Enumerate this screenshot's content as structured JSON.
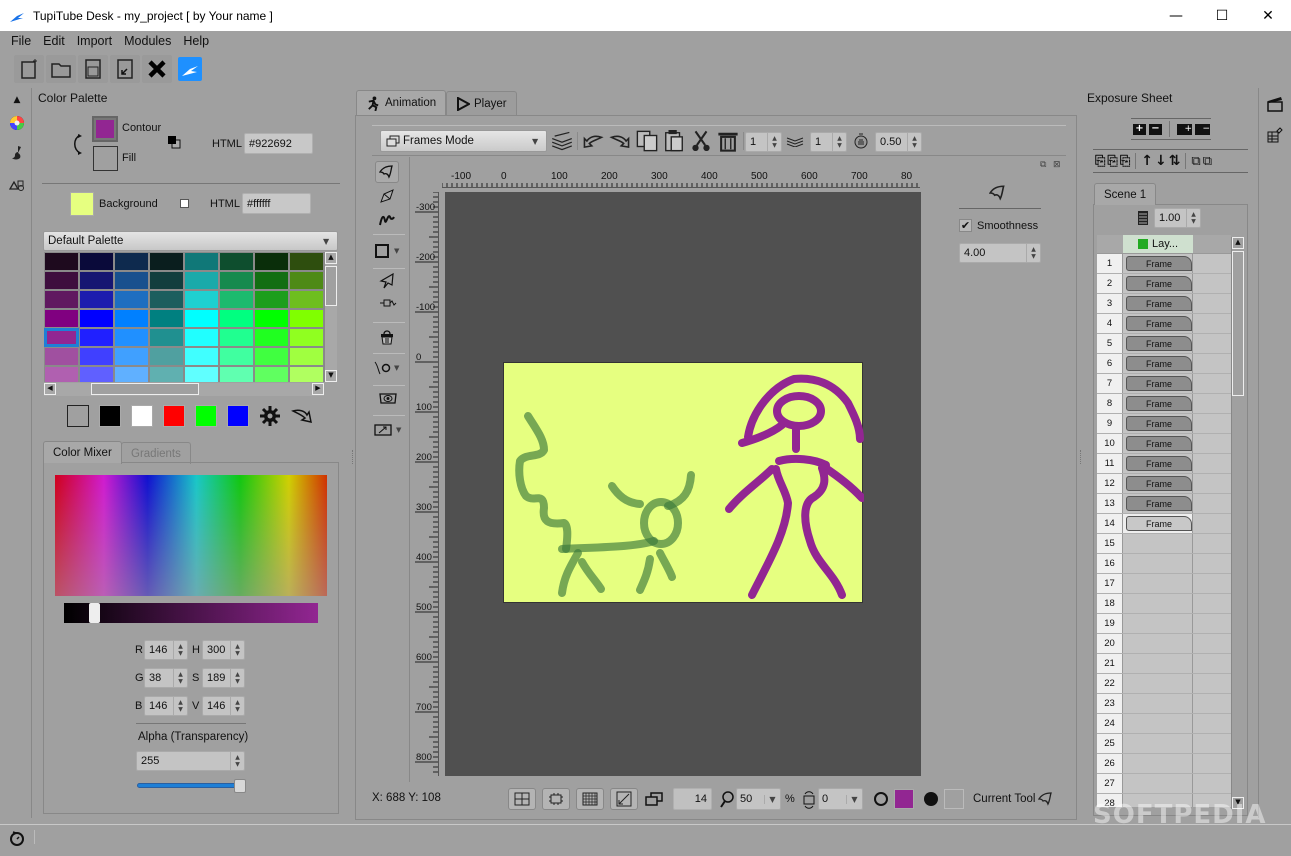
{
  "window": {
    "title": "TupiTube Desk - my_project [ by Your name ]",
    "controls": {
      "minimize": "—",
      "maximize": "☐",
      "close": "✕"
    }
  },
  "menu": [
    "File",
    "Edit",
    "Import",
    "Modules",
    "Help"
  ],
  "toolbar": {
    "icons": [
      "new-project-icon",
      "open-project-icon",
      "save-icon",
      "save-as-icon",
      "close-project-icon",
      "tupitube-icon"
    ]
  },
  "left_sidebar": {
    "icons": [
      "collapse-up-icon",
      "color-wheel-icon",
      "brush-icon",
      "shapes-icon"
    ]
  },
  "color_palette": {
    "title": "Color Palette",
    "contour_label": "Contour",
    "fill_label": "Fill",
    "html_label": "HTML",
    "contour_html": "#922692",
    "contour_color": "#922692",
    "background_label": "Background",
    "background_html_label": "HTML",
    "background_html": "#ffffff",
    "background_color": "#e6ff80",
    "palette_select": "Default Palette",
    "palette_colors": [
      [
        "#1e0a1e",
        "#0a0a3a",
        "#0e2a4e",
        "#0a1e1e",
        "#107878",
        "#0e4e2e",
        "#0a2e0a",
        "#2e4e0e"
      ],
      [
        "#3e0e3e",
        "#161672",
        "#18508e",
        "#123e3e",
        "#1aaaaa",
        "#168a4e",
        "#126e12",
        "#4e8a16"
      ],
      [
        "#601860",
        "#1c1cae",
        "#1e6ec0",
        "#1c5e5e",
        "#1ed0d0",
        "#1cba6e",
        "#1c9e1c",
        "#6ebe1e"
      ],
      [
        "#800080",
        "#0000ff",
        "#0080ff",
        "#008080",
        "#00ffff",
        "#00ff80",
        "#00ff00",
        "#80ff00"
      ],
      [
        "#922692",
        "#2020ff",
        "#2090ff",
        "#209090",
        "#20ffff",
        "#20ff90",
        "#20ff20",
        "#90ff20"
      ],
      [
        "#a050a0",
        "#4040ff",
        "#40a0ff",
        "#50a0a0",
        "#40ffff",
        "#40ffa0",
        "#40ff40",
        "#a0ff40"
      ],
      [
        "#b060b0",
        "#6060ff",
        "#60b0ff",
        "#60b0b0",
        "#60ffff",
        "#60ffb0",
        "#60ff60",
        "#b0ff60"
      ]
    ],
    "quick_colors": [
      "transparent",
      "#000000",
      "#ffffff",
      "#ff0000",
      "#00ff00",
      "#0000ff"
    ]
  },
  "color_mixer": {
    "tabs": [
      "Color Mixer",
      "Gradients"
    ],
    "R": "146",
    "G": "38",
    "B": "146",
    "H": "300",
    "S": "189",
    "V": "146",
    "alpha_label": "Alpha (Transparency)",
    "alpha": "255",
    "alpha_fraction": 1.0,
    "value_slider_fraction": 0.1
  },
  "main_tabs": [
    "Animation",
    "Player"
  ],
  "canvas_toolbar": {
    "mode": "Frames Mode",
    "spin1": "1",
    "spin2": "1",
    "opacity": "0.50"
  },
  "rulers": {
    "horizontal": [
      "-100",
      "0",
      "100",
      "200",
      "300",
      "400",
      "500",
      "600",
      "700",
      "80"
    ],
    "vertical": [
      "-300",
      "-200",
      "-100",
      "0",
      "100",
      "200",
      "300",
      "400",
      "500",
      "600",
      "700",
      "800"
    ]
  },
  "tool_options": {
    "smoothness_label": "Smoothness",
    "smoothness_checked": true,
    "smoothness_value": "4.00"
  },
  "status": {
    "coords": "X: 688 Y: 108",
    "frame": "14",
    "zoom": "50",
    "zoom_unit": "%",
    "rotation": "0",
    "stroke_color": "#922692",
    "fill_color": "#a0a0a0",
    "current_tool_label": "Current Tool"
  },
  "exposure_sheet": {
    "title": "Exposure Sheet",
    "scene_tab": "Scene 1",
    "fps": "1.00",
    "layer_label": "Lay...",
    "layer_color": "#22aa22",
    "frame_label": "Frame",
    "filled_frames": 14,
    "rows": [
      "1",
      "2",
      "3",
      "4",
      "5",
      "6",
      "7",
      "8",
      "9",
      "10",
      "11",
      "12",
      "13",
      "14",
      "15",
      "16",
      "17",
      "18",
      "19",
      "20",
      "21",
      "22",
      "23",
      "24",
      "25",
      "26",
      "27",
      "28"
    ]
  },
  "watermark": "SOFTPEDIA"
}
